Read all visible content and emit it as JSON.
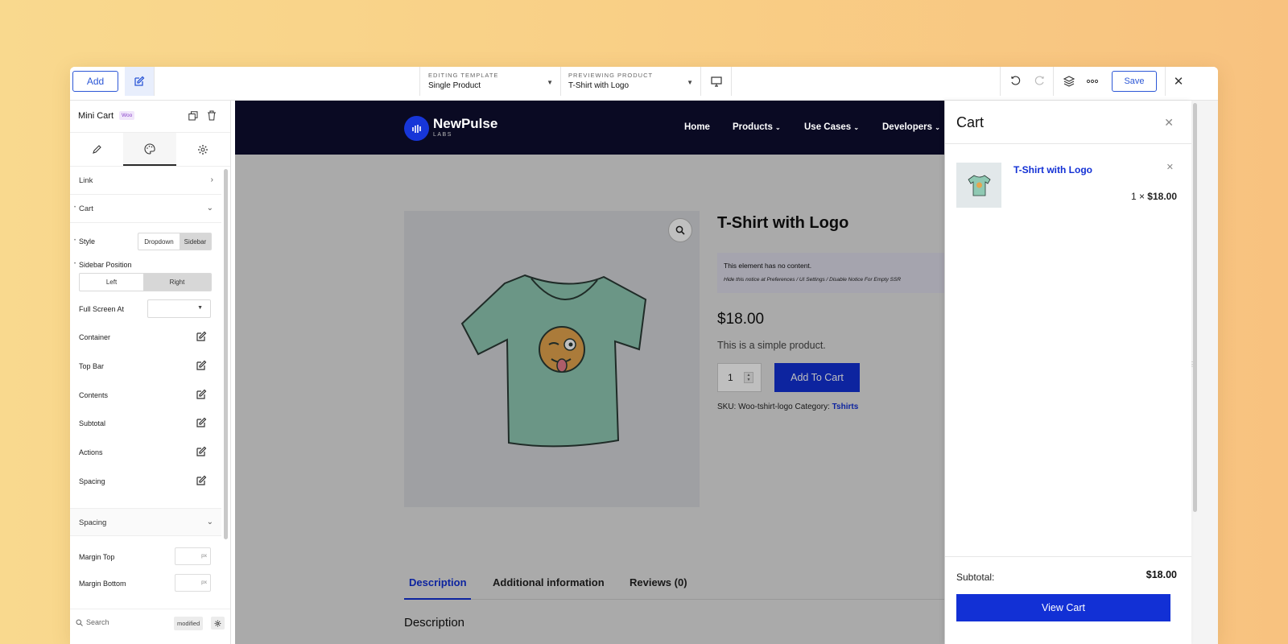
{
  "toolbar": {
    "add_label": "Add",
    "editing_caption": "EDITING TEMPLATE",
    "editing_value": "Single Product",
    "previewing_caption": "PREVIEWING PRODUCT",
    "previewing_value": "T-Shirt with Logo",
    "save_label": "Save"
  },
  "panel": {
    "title": "Mini Cart",
    "badge": "Woo",
    "sections": {
      "link": "Link",
      "cart": "Cart",
      "spacing": "Spacing"
    },
    "style_label": "Style",
    "style_options": [
      "Dropdown",
      "Sidebar"
    ],
    "style_selected": "Sidebar",
    "sidebar_position_label": "Sidebar Position",
    "position_options": [
      "Left",
      "Right"
    ],
    "position_selected": "Right",
    "full_screen_label": "Full Screen At",
    "edit_rows": [
      "Container",
      "Top Bar",
      "Contents",
      "Subtotal",
      "Actions",
      "Spacing"
    ],
    "margin_top_label": "Margin Top",
    "margin_bottom_label": "Margin Bottom",
    "unit": "px",
    "search_label": "Search",
    "modified_label": "modified"
  },
  "site": {
    "logo_name": "NewPulse",
    "logo_sub": "LABS",
    "nav": [
      "Home",
      "Products",
      "Use Cases",
      "Developers"
    ]
  },
  "product": {
    "title": "T-Shirt with Logo",
    "notice_title": "This element has no content.",
    "notice_hint": "Hide this notice at Preferences / UI Settings / Disable Notice For Empty SSR",
    "price": "$18.00",
    "short_desc": "This is a simple product.",
    "qty": "1",
    "add_to_cart": "Add To Cart",
    "sku_label": "SKU:",
    "sku_value": "Woo-tshirt-logo",
    "category_label": "Category:",
    "category_value": "Tshirts",
    "tabs": [
      "Description",
      "Additional information",
      "Reviews (0)"
    ],
    "description_heading": "Description"
  },
  "cart": {
    "title": "Cart",
    "item_name": "T-Shirt with Logo",
    "item_qty": "1 ×",
    "item_price": "$18.00",
    "subtotal_label": "Subtotal:",
    "subtotal_value": "$18.00",
    "view_cart": "View Cart"
  },
  "colors": {
    "accent": "#1230d5",
    "nav_bg": "#0a0a23",
    "badge": "#8a45c9"
  }
}
